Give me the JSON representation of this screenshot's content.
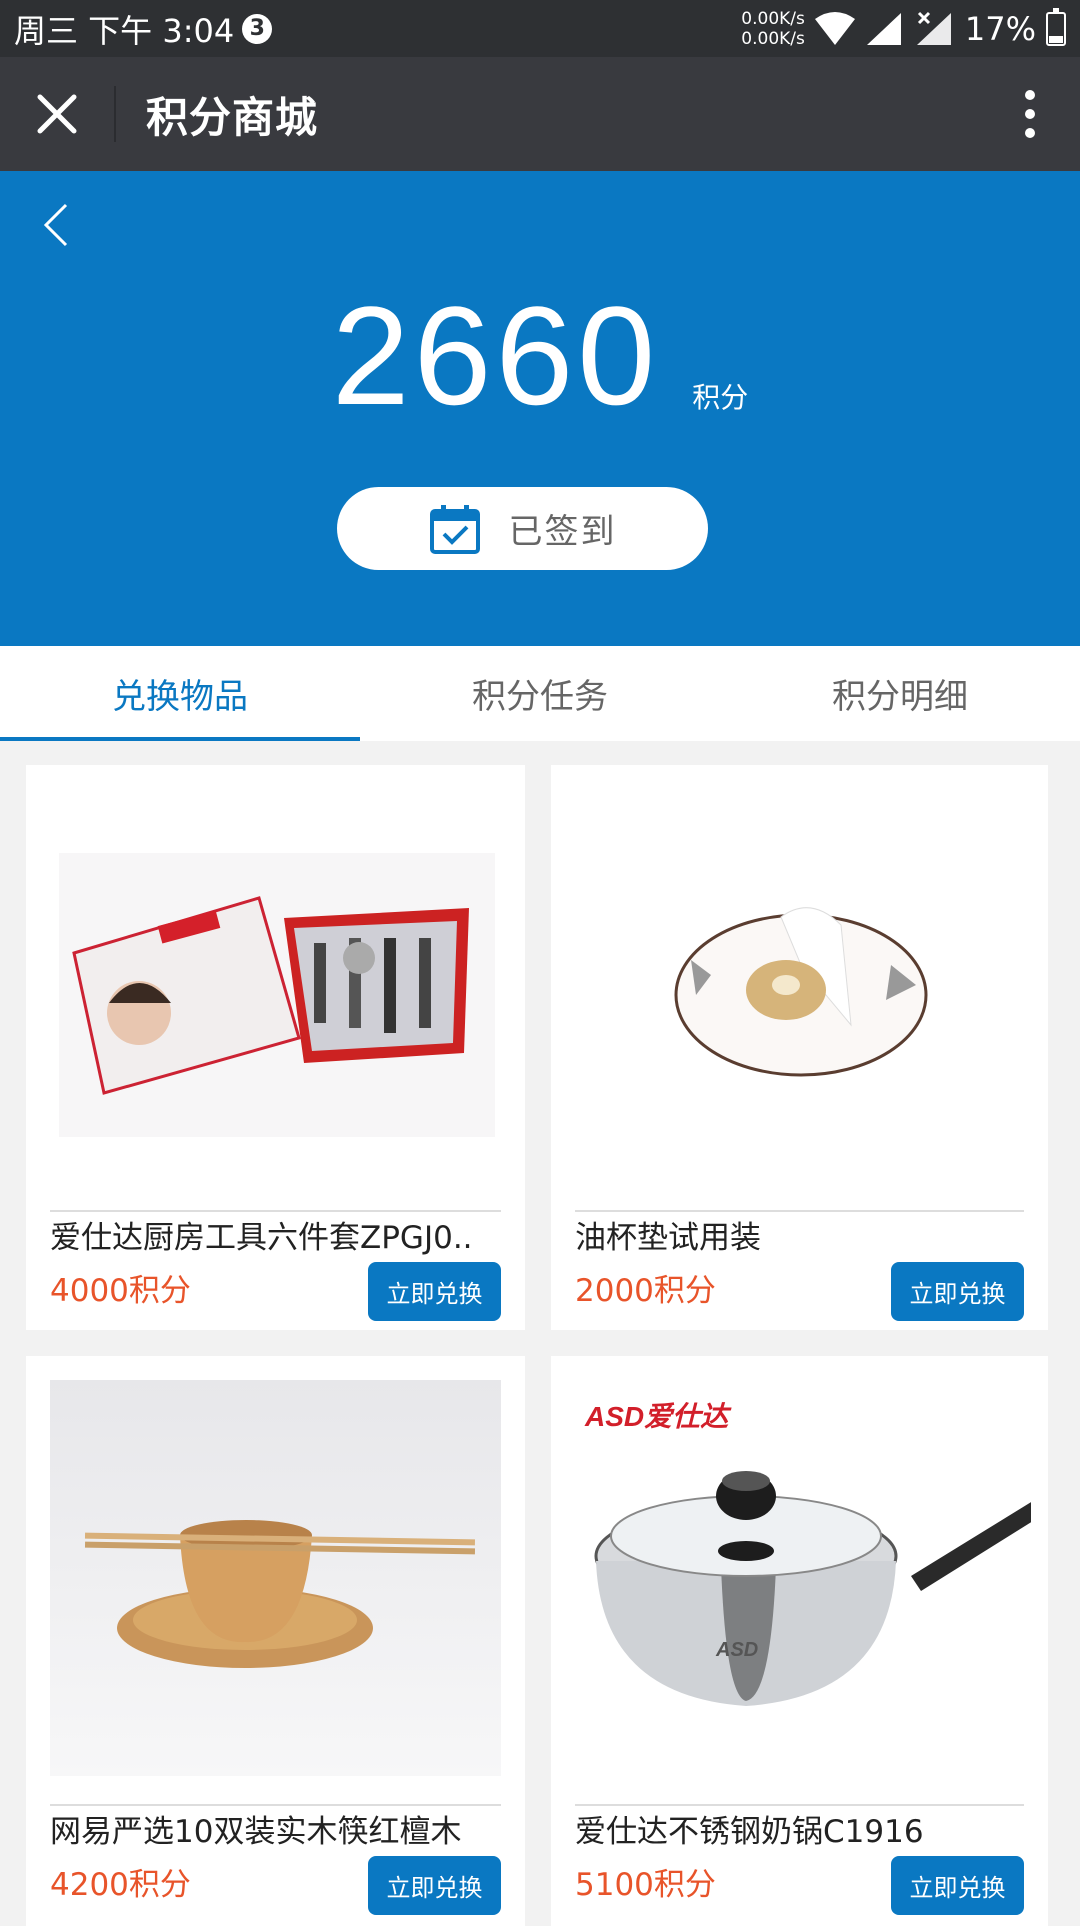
{
  "status_bar": {
    "time": "周三 下午 3:04",
    "notification_count": "3",
    "net_up": "0.00K/s",
    "net_down": "0.00K/s",
    "battery": "17%"
  },
  "title_bar": {
    "title": "积分商城"
  },
  "header": {
    "points": "2660",
    "points_unit": "积分",
    "signin_label": "已签到"
  },
  "tabs": [
    {
      "label": "兑换物品",
      "active": true
    },
    {
      "label": "积分任务",
      "active": false
    },
    {
      "label": "积分明细",
      "active": false
    }
  ],
  "products": [
    {
      "name": "爱仕达厨房工具六件套ZPGJ0..",
      "price": "4000积分",
      "button": "立即兑换",
      "image": "kitchen-tool-set-image"
    },
    {
      "name": "油杯垫试用装",
      "price": "2000积分",
      "button": "立即兑换",
      "image": "oil-cup-pad-image"
    },
    {
      "name": "网易严选10双装实木筷红檀木",
      "price": "4200积分",
      "button": "立即兑换",
      "image": "wooden-bowl-chopsticks-image"
    },
    {
      "name": "爱仕达不锈钢奶锅C1916",
      "price": "5100积分",
      "button": "立即兑换",
      "image": "milk-pot-image",
      "brand": "ASD爱仕达"
    }
  ],
  "colors": {
    "accent": "#0a78c2",
    "price": "#e8542a",
    "titlebar": "#393a3f",
    "statusbar": "#2e3033"
  }
}
